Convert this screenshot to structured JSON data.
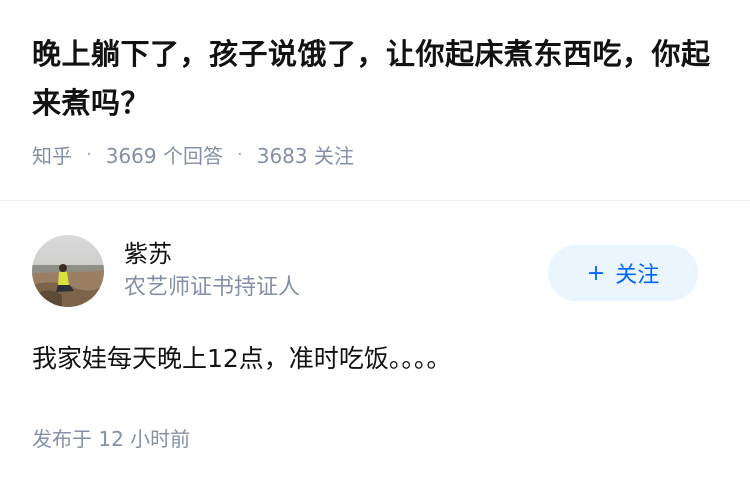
{
  "question": {
    "title": "晚上躺下了，孩子说饿了，让你起床煮东西吃，你起来煮吗？",
    "source": "知乎",
    "answers_count": "3669 个回答",
    "followers_count": "3683 关注"
  },
  "answer": {
    "author": {
      "name": "紫苏",
      "bio": "农艺师证书持证人"
    },
    "follow_label": "关注",
    "content": "我家娃每天晚上12点，准时吃饭。。。。",
    "time": "发布于 12 小时前"
  },
  "colors": {
    "accent": "#0066ff",
    "follow_bg": "#ebf5ff",
    "meta_gray": "#8590a6"
  }
}
